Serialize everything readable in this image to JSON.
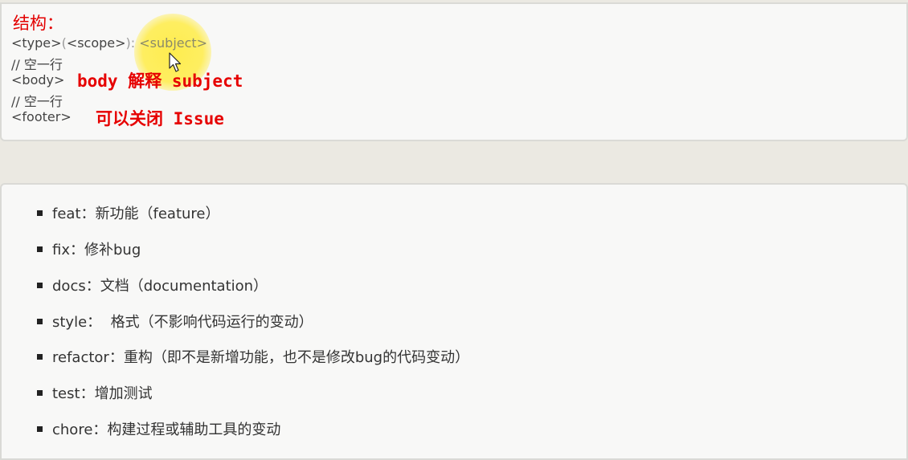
{
  "structure": {
    "title": "结构：",
    "line1": {
      "type": "<type>",
      "paren_open": "(",
      "scope": "<scope>",
      "paren_close": "):",
      "subject": " <subject>"
    },
    "line2": "// 空一行",
    "line3": "<body>",
    "line4": "// 空一行",
    "line5": "<footer>"
  },
  "annotations": {
    "body_note": "body 解释 subject",
    "footer_note": "可以关闭 Issue"
  },
  "types": [
    {
      "key": "feat",
      "sep": "：",
      "desc": "新功能（feature）"
    },
    {
      "key": "fix",
      "sep": "：",
      "desc": "修补bug"
    },
    {
      "key": "docs",
      "sep": "：",
      "desc": "文档（documentation）"
    },
    {
      "key": "style",
      "sep": "：  ",
      "desc": "格式（不影响代码运行的变动）"
    },
    {
      "key": "refactor",
      "sep": "：",
      "desc": "重构（即不是新增功能，也不是修改bug的代码变动）"
    },
    {
      "key": "test",
      "sep": "：",
      "desc": "增加测试"
    },
    {
      "key": "chore",
      "sep": "：",
      "desc": "构建过程或辅助工具的变动"
    }
  ],
  "icons": {
    "cursor": "mouse-pointer-icon",
    "bullet": "square-bullet-icon"
  },
  "colors": {
    "annotation": "#e60000",
    "highlight": "#ffec46"
  }
}
